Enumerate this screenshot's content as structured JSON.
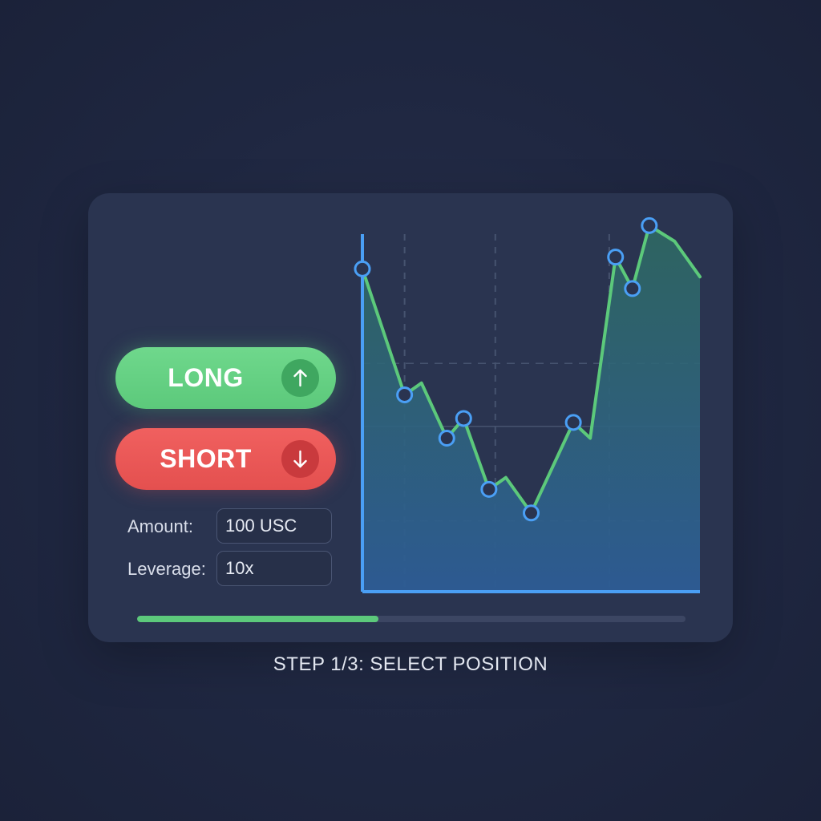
{
  "buttons": {
    "long": {
      "label": "LONG",
      "icon": "arrow-up-icon",
      "color": "#5cc97b"
    },
    "short": {
      "label": "SHORT",
      "icon": "arrow-down-icon",
      "color": "#e4504f"
    }
  },
  "form": {
    "amount": {
      "label": "Amount:",
      "value": "100 USC"
    },
    "leverage": {
      "label": "Leverage:",
      "value": "10x"
    }
  },
  "progress": {
    "fraction": 0.44
  },
  "step": {
    "caption": "STEP 1/3: SELECT POSITION"
  },
  "colors": {
    "line": "#5cc97b",
    "marker": "#4a9ff5",
    "axis": "#4a9ff5",
    "area_top": "#2f6c63",
    "area_bottom": "#2d5c95"
  },
  "chart_data": {
    "type": "line",
    "x": [
      0,
      1,
      1.4,
      2,
      2.4,
      3,
      3.4,
      4,
      5,
      5.4,
      6,
      6.4,
      6.8,
      7.4,
      8
    ],
    "values": [
      82,
      50,
      53,
      39,
      44,
      26,
      29,
      20,
      43,
      39,
      85,
      77,
      93,
      89,
      80
    ],
    "markers": [
      true,
      true,
      false,
      true,
      true,
      true,
      false,
      true,
      true,
      false,
      true,
      true,
      true,
      false,
      false
    ],
    "xlim": [
      0,
      8
    ],
    "ylim": [
      0,
      100
    ],
    "grid": true
  }
}
